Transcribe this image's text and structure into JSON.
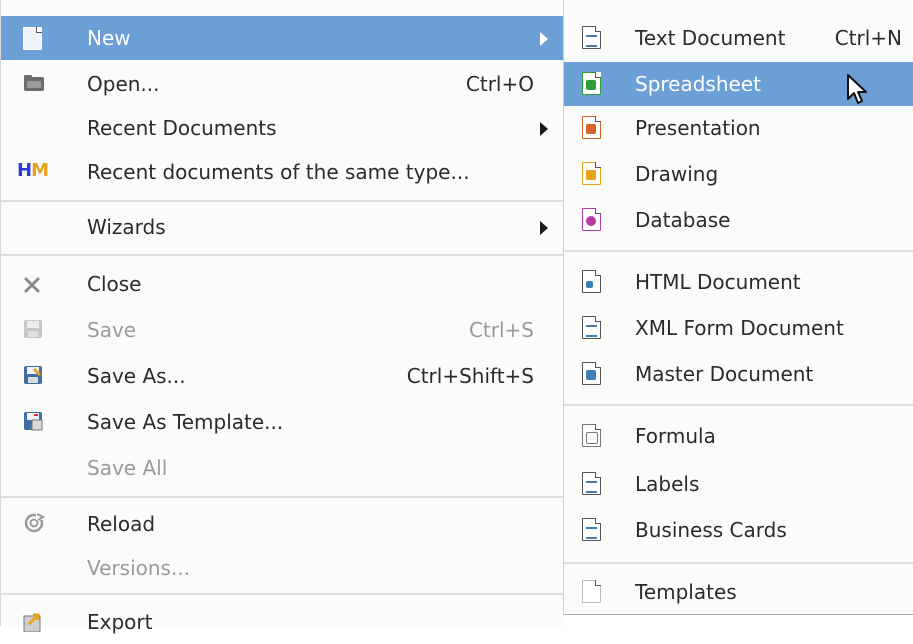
{
  "file_menu": {
    "items": [
      {
        "label": "New",
        "shortcut": "",
        "submenu": true,
        "icon": "new-document-icon"
      },
      {
        "label": "Open...",
        "shortcut": "Ctrl+O",
        "icon": "folder-icon"
      },
      {
        "label": "Recent Documents",
        "shortcut": "",
        "submenu": true
      },
      {
        "label": "Recent documents of the same type...",
        "shortcut": "",
        "icon": "hm-icon",
        "icon_text": "HM"
      },
      {
        "label": "Wizards",
        "shortcut": "",
        "submenu": true
      },
      {
        "label": "Close",
        "shortcut": "",
        "icon": "close-icon"
      },
      {
        "label": "Save",
        "shortcut": "Ctrl+S",
        "disabled": true,
        "icon": "save-icon"
      },
      {
        "label": "Save As...",
        "shortcut": "Ctrl+Shift+S",
        "icon": "save-as-icon"
      },
      {
        "label": "Save As Template...",
        "shortcut": "",
        "icon": "save-template-icon"
      },
      {
        "label": "Save All",
        "shortcut": "",
        "disabled": true
      },
      {
        "label": "Reload",
        "shortcut": "",
        "icon": "reload-icon"
      },
      {
        "label": "Versions...",
        "shortcut": "",
        "disabled": true
      },
      {
        "label": "Export",
        "shortcut": "",
        "icon": "export-icon"
      }
    ]
  },
  "new_submenu": {
    "items": [
      {
        "label": "Text Document",
        "shortcut": "Ctrl+N",
        "icon": "text-document-icon",
        "color": "#3f7fb8"
      },
      {
        "label": "Spreadsheet",
        "shortcut": "",
        "icon": "spreadsheet-icon",
        "color": "#2e9e3a",
        "highlighted": true
      },
      {
        "label": "Presentation",
        "shortcut": "",
        "icon": "presentation-icon",
        "color": "#d5622a"
      },
      {
        "label": "Drawing",
        "shortcut": "",
        "icon": "drawing-icon",
        "color": "#e5a21b"
      },
      {
        "label": "Database",
        "shortcut": "",
        "icon": "database-icon",
        "color": "#b63aa8"
      },
      {
        "label": "HTML Document",
        "shortcut": "",
        "icon": "html-document-icon",
        "color": "#3f7fb8"
      },
      {
        "label": "XML Form Document",
        "shortcut": "",
        "icon": "xml-form-document-icon",
        "color": "#3f7fb8"
      },
      {
        "label": "Master Document",
        "shortcut": "",
        "icon": "master-document-icon",
        "color": "#3f7fb8"
      },
      {
        "label": "Formula",
        "shortcut": "",
        "icon": "formula-icon",
        "color": "#777777"
      },
      {
        "label": "Labels",
        "shortcut": "",
        "icon": "labels-icon",
        "color": "#3f7fb8"
      },
      {
        "label": "Business Cards",
        "shortcut": "",
        "icon": "business-cards-icon",
        "color": "#3f7fb8"
      },
      {
        "label": "Templates",
        "shortcut": "",
        "icon": "templates-icon",
        "color": "#bbbbbb"
      }
    ]
  },
  "colors": {
    "highlight": "#6b9fd6",
    "menu_bg": "#fbfbfa",
    "disabled_text": "#9a9a9a"
  },
  "cursor_icon": "mouse-pointer-icon"
}
